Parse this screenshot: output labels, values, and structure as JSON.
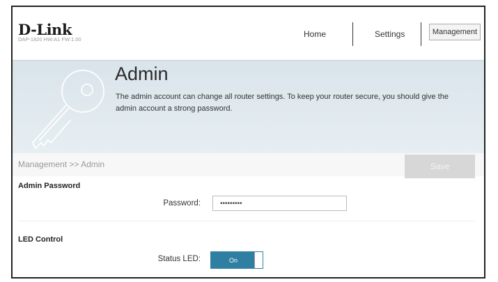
{
  "header": {
    "logo": "D-Link",
    "model_info": "DAP-1820  HW:A1  FW:1.00",
    "nav": {
      "home": "Home",
      "settings": "Settings",
      "management": "Management"
    }
  },
  "banner": {
    "title": "Admin",
    "description": "The admin account can change all router settings. To keep your router secure, you should give the admin account a strong password.",
    "icon": "key-icon"
  },
  "breadcrumb": {
    "text": "Management >> Admin",
    "save_label": "Save"
  },
  "admin_password": {
    "section_title": "Admin Password",
    "label": "Password:",
    "value": "•••••••••"
  },
  "led_control": {
    "section_title": "LED Control",
    "label": "Status LED:",
    "toggle_label": "On",
    "toggle_state": true
  },
  "colors": {
    "accent": "#2f7fa3",
    "banner": "#dfe8ed",
    "save_disabled": "#d7d7d7"
  }
}
